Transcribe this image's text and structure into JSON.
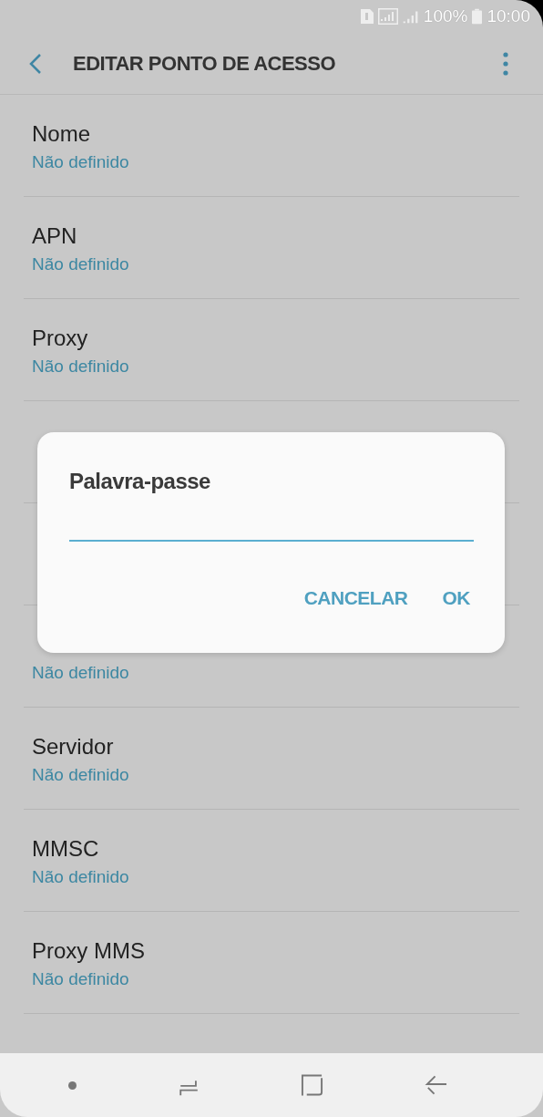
{
  "status_bar": {
    "battery": "100%",
    "time": "10:00"
  },
  "header": {
    "title": "EDITAR PONTO DE ACESSO"
  },
  "settings": [
    {
      "title": "Nome",
      "value": "Não definido"
    },
    {
      "title": "APN",
      "value": "Não definido"
    },
    {
      "title": "Proxy",
      "value": "Não definido"
    },
    {
      "value": "Não definido"
    },
    {
      "title": "Servidor",
      "value": "Não definido"
    },
    {
      "title": "MMSC",
      "value": "Não definido"
    },
    {
      "title": "Proxy MMS",
      "value": "Não definido"
    }
  ],
  "dialog": {
    "title": "Palavra-passe",
    "buttons": [
      "CANCELAR",
      "OK"
    ]
  }
}
